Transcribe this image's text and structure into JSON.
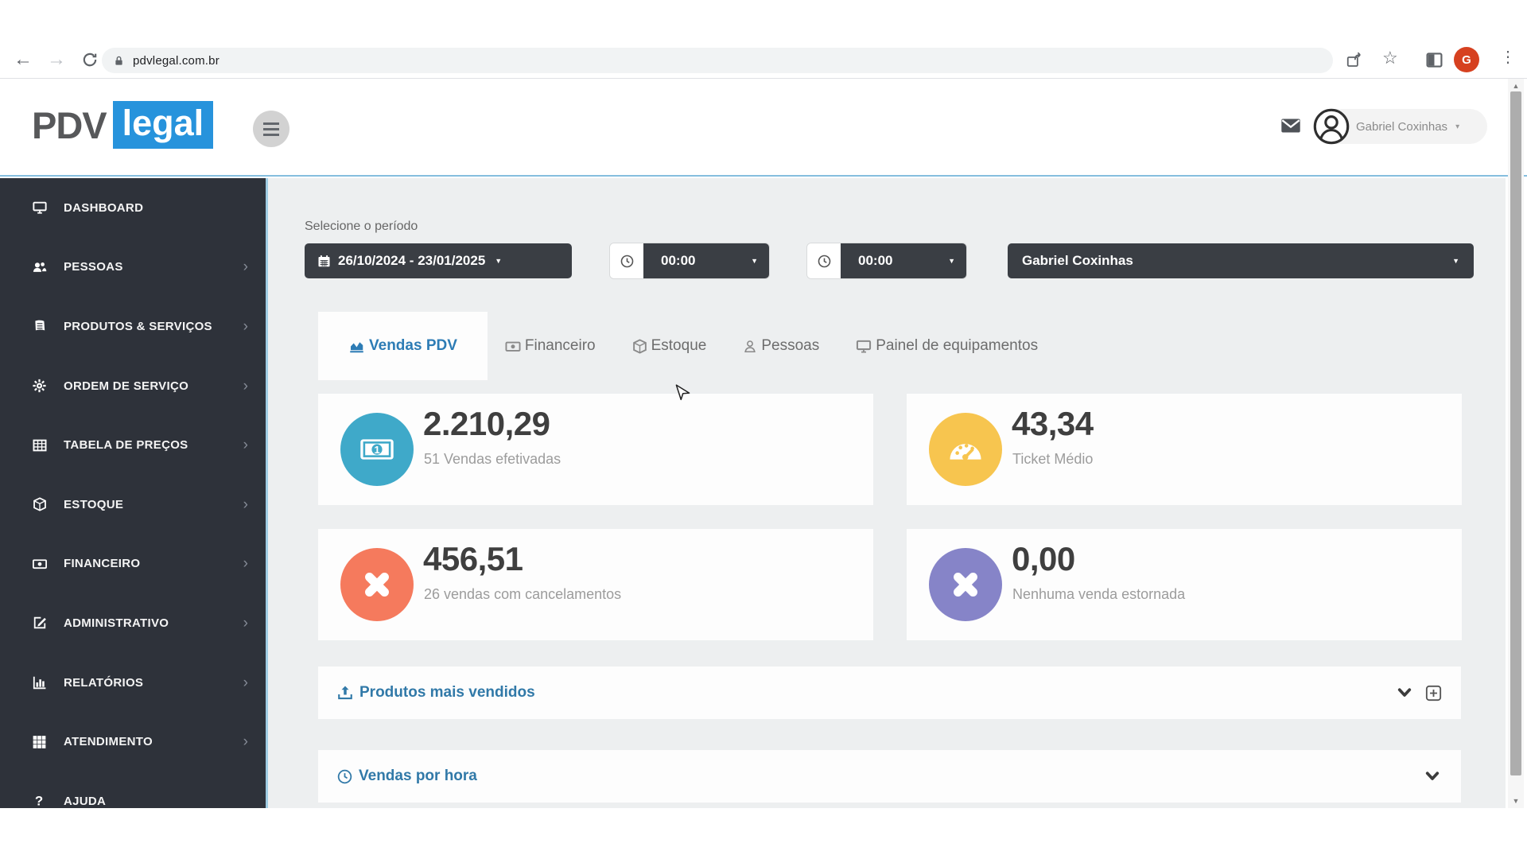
{
  "browser": {
    "url": "pdvlegal.com.br",
    "profile_initial": "G",
    "icons": [
      "back",
      "forward",
      "reload",
      "lock",
      "share",
      "bookmark-star",
      "side-panel",
      "profile",
      "menu-dots"
    ]
  },
  "header": {
    "logo": {
      "pdv": "PDV",
      "legal": "legal"
    },
    "user_name": "Gabriel Coxinhas",
    "icons": [
      "hamburger-menu",
      "envelope",
      "user-avatar",
      "caret-down"
    ]
  },
  "sidebar": {
    "items": [
      {
        "label": "DASHBOARD",
        "icon": "monitor",
        "chevron": false
      },
      {
        "label": "PESSOAS",
        "icon": "users",
        "chevron": true
      },
      {
        "label": "PRODUTOS & SERVIÇOS",
        "icon": "book",
        "chevron": true
      },
      {
        "label": "ORDEM DE SERVIÇO",
        "icon": "gear",
        "chevron": true
      },
      {
        "label": "TABELA DE PREÇOS",
        "icon": "table",
        "chevron": true
      },
      {
        "label": "ESTOQUE",
        "icon": "cube",
        "chevron": true
      },
      {
        "label": "FINANCEIRO",
        "icon": "banknote",
        "chevron": true
      },
      {
        "label": "ADMINISTRATIVO",
        "icon": "edit",
        "chevron": true
      },
      {
        "label": "RELATÓRIOS",
        "icon": "bar-chart",
        "chevron": true
      },
      {
        "label": "ATENDIMENTO",
        "icon": "grid",
        "chevron": true
      },
      {
        "label": "AJUDA",
        "icon": "question",
        "chevron": false
      }
    ]
  },
  "filters": {
    "label": "Selecione o período",
    "date_range": "26/10/2024 - 23/01/2025",
    "time_start": "00:00",
    "time_end": "00:00",
    "consultant": "Gabriel Coxinhas"
  },
  "tabs": [
    {
      "label": "Vendas PDV",
      "icon": "area-chart",
      "active": true
    },
    {
      "label": "Financeiro",
      "icon": "banknote",
      "active": false
    },
    {
      "label": "Estoque",
      "icon": "cube",
      "active": false
    },
    {
      "label": "Pessoas",
      "icon": "person",
      "active": false
    },
    {
      "label": "Painel de equipamentos",
      "icon": "monitor",
      "active": false
    }
  ],
  "cards": [
    {
      "value": "2.210,29",
      "caption": "51 Vendas efetivadas",
      "icon": "banknote",
      "color": "#3fa9c9"
    },
    {
      "value": "43,34",
      "caption": "Ticket Médio",
      "icon": "gauge",
      "color": "#f7c54f"
    },
    {
      "value": "456,51",
      "caption": "26 vendas com cancelamentos",
      "icon": "x-mark",
      "color": "#f57a5d"
    },
    {
      "value": "0,00",
      "caption": "Nenhuma venda estornada",
      "icon": "x-mark",
      "color": "#8684c8"
    }
  ],
  "panels": [
    {
      "title": "Produtos mais vendidos",
      "icon": "upload",
      "controls": [
        "collapse-chevron",
        "expand-plus"
      ]
    },
    {
      "title": "Vendas por hora",
      "icon": "clock",
      "controls": [
        "collapse-chevron"
      ]
    }
  ],
  "colors": {
    "accent_blue_line": "#85bede",
    "logo_blue": "#2793dc",
    "sidebar_bg": "#2e323a",
    "control_dark": "#3a3e44",
    "tab_active_blue": "#2d7cb5",
    "panel_title_blue": "#3179a8",
    "card_teal": "#3fa9c9",
    "card_yellow": "#f7c54f",
    "card_orange": "#f57a5d",
    "card_purple": "#8684c8"
  }
}
